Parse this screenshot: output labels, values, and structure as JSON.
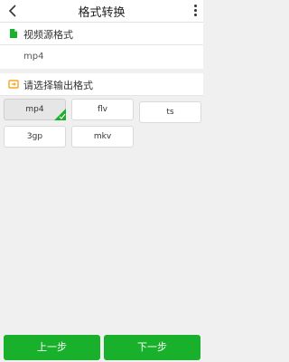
{
  "header": {
    "title": "格式转换",
    "back_icon": "chevron-left-icon",
    "menu_icon": "more-vertical-icon"
  },
  "source": {
    "label": "视频源格式",
    "value": "mp4",
    "icon": "file-icon",
    "icon_color": "#19b02c"
  },
  "output": {
    "label": "请选择输出格式",
    "icon": "convert-icon",
    "icon_color": "#f5a623",
    "formats": [
      "mp4",
      "flv",
      "ts",
      "3gp",
      "mkv"
    ],
    "selected": "mp4"
  },
  "buttons": {
    "prev": "上一步",
    "next": "下一步",
    "color": "#19b02c"
  }
}
